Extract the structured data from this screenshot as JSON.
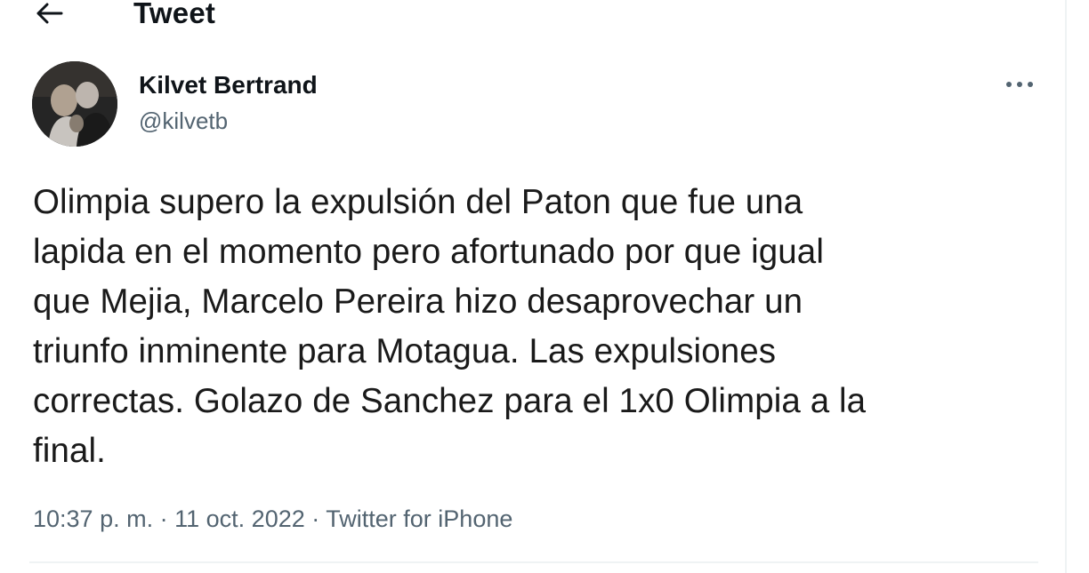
{
  "header": {
    "title": "Tweet",
    "back_icon": "arrow-left-icon"
  },
  "tweet": {
    "author": {
      "display_name": "Kilvet Bertrand",
      "handle": "@kilvetb"
    },
    "more_icon": "more-dots-icon",
    "text": "Olimpia supero la expulsión del Paton que fue una\nlapida en el momento pero afortunado por que igual\nque Mejia, Marcelo Pereira hizo desaprovechar un\ntriunfo inminente para Motagua. Las expulsiones\ncorrectas. Golazo de Sanchez para el 1x0 Olimpia a la\nfinal.",
    "time": "10:37 p. m.",
    "separator": "·",
    "date": "11 oct. 2022",
    "source": "Twitter for iPhone"
  },
  "colors": {
    "text_primary": "#0f1419",
    "text_secondary": "#536471",
    "divider": "#eff3f4"
  }
}
